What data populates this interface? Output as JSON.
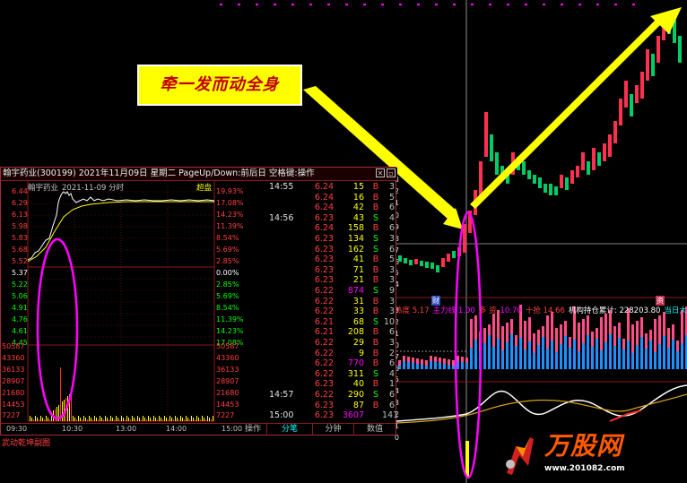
{
  "callout": {
    "text": "牵一发而动全身"
  },
  "kline_chart": {
    "markers": {
      "finance_left": "财",
      "finance_right": "资"
    },
    "indicator_line": [
      {
        "text": "热度 5.17",
        "color": "#ff4040"
      },
      {
        "text": "主力线 1.00",
        "color": "#ff00ff"
      },
      {
        "text": "多 资",
        "color": "#ff4040"
      },
      {
        "text": "10.70",
        "color": "#ff00ff"
      },
      {
        "text": "十抢 14.66",
        "color": "#ff4040"
      },
      {
        "text": "机构持仓累计: 228203.80",
        "color": "#ffffff"
      },
      {
        "text": "当日大力度建仓",
        "color": "#00ffff"
      }
    ],
    "right_axis": [
      "3",
      "2",
      "1",
      "0",
      "9",
      "8",
      "7",
      "6",
      "5",
      "4",
      "3",
      "2",
      "1",
      "0",
      "7",
      "6",
      "5",
      "4",
      "3",
      "2",
      "1",
      "0"
    ]
  },
  "popup": {
    "title": "翰宇药业(300199) 2021年11月09日 星期二 PageUp/Down:前后日 空格键:操作",
    "chart_label": "翰宇药业",
    "chart_date": "2021-11-09 分时",
    "overlay_tag": "超盘",
    "price_labels": [
      "6.44",
      "6.29",
      "6.13",
      "5.98",
      "5.83",
      "5.68",
      "5.52",
      "5.37",
      "5.22",
      "5.06",
      "4.91",
      "4.76",
      "4.61",
      "4.45"
    ],
    "pct_labels": [
      "19.93%",
      "17.08%",
      "14.23%",
      "11.39%",
      "8.54%",
      "5.69%",
      "2.85%",
      "0.00%",
      "2.85%",
      "5.69%",
      "8.54%",
      "11.39%",
      "14.23%",
      "17.08%"
    ],
    "vol_labels_left": [
      "50587",
      "43360",
      "36133",
      "28907",
      "21680",
      "14453",
      "7227"
    ],
    "vol_labels_right": [
      "50587",
      "43360",
      "36133",
      "28907",
      "21680",
      "14453",
      "7227"
    ],
    "time_labels": [
      "09:30",
      "10:30",
      "13:00",
      "14:00",
      "15:00"
    ],
    "trades": [
      {
        "time": "14:55",
        "price": "6.24",
        "vol": "15",
        "bs": "B",
        "n": "3"
      },
      {
        "time": "",
        "price": "6.24",
        "vol": "16",
        "bs": "B",
        "n": "5"
      },
      {
        "time": "",
        "price": "6.24",
        "vol": "42",
        "bs": "B",
        "n": "6"
      },
      {
        "time": "14:56",
        "price": "6.23",
        "vol": "43",
        "bs": "S",
        "n": "4"
      },
      {
        "time": "",
        "price": "6.24",
        "vol": "158",
        "bs": "B",
        "n": "6"
      },
      {
        "time": "",
        "price": "6.23",
        "vol": "134",
        "bs": "S",
        "n": "3"
      },
      {
        "time": "",
        "price": "6.23",
        "vol": "162",
        "bs": "S",
        "n": "6"
      },
      {
        "time": "",
        "price": "6.23",
        "vol": "41",
        "bs": "B",
        "n": "5"
      },
      {
        "time": "",
        "price": "6.23",
        "vol": "71",
        "bs": "B",
        "n": "3"
      },
      {
        "time": "",
        "price": "6.23",
        "vol": "21",
        "bs": "B",
        "n": "3"
      },
      {
        "time": "",
        "price": "6.22",
        "vol": "874",
        "bs": "S",
        "n": "9"
      },
      {
        "time": "",
        "price": "6.22",
        "vol": "31",
        "bs": "B",
        "n": "3"
      },
      {
        "time": "",
        "price": "6.22",
        "vol": "33",
        "bs": "B",
        "n": "3"
      },
      {
        "time": "",
        "price": "6.21",
        "vol": "68",
        "bs": "S",
        "n": "10"
      },
      {
        "time": "",
        "price": "6.21",
        "vol": "208",
        "bs": "B",
        "n": "6"
      },
      {
        "time": "",
        "price": "6.22",
        "vol": "29",
        "bs": "B",
        "n": "3"
      },
      {
        "time": "",
        "price": "6.22",
        "vol": "9",
        "bs": "B",
        "n": "2"
      },
      {
        "time": "",
        "price": "6.22",
        "vol": "770",
        "bs": "B",
        "n": "6"
      },
      {
        "time": "",
        "price": "6.22",
        "vol": "311",
        "bs": "S",
        "n": "4"
      },
      {
        "time": "",
        "price": "6.23",
        "vol": "40",
        "bs": "B",
        "n": "1"
      },
      {
        "time": "14:57",
        "price": "6.22",
        "vol": "290",
        "bs": "S",
        "n": "6"
      },
      {
        "time": "",
        "price": "6.23",
        "vol": "87",
        "bs": "B",
        "n": "6"
      },
      {
        "time": "15:00",
        "price": "6.23",
        "vol": "3607",
        "bs": "",
        "n": "141"
      }
    ],
    "footer": {
      "ops": "操作",
      "tab1": "分笔",
      "tab2": "分钟",
      "tab3": "数值"
    }
  },
  "bottom_label": "武动乾坤副图",
  "watermark": {
    "brand": "万股网",
    "url": "www.201082.com"
  }
}
